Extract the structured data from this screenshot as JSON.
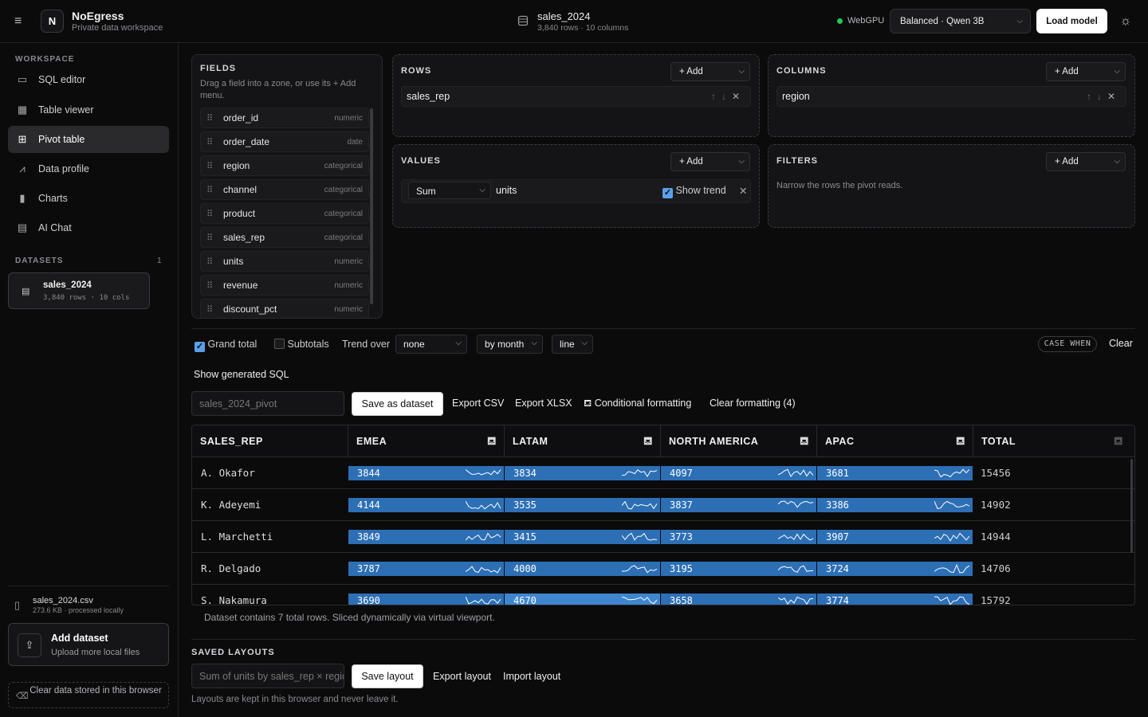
{
  "app": {
    "name": "NoEgress",
    "subtitle": "Private data workspace"
  },
  "header": {
    "dataset_name": "sales_2024",
    "dataset_meta": "3,840 rows · 10 columns",
    "gpu_label": "WebGPU",
    "model_select": "Balanced · Qwen 3B",
    "load_model": "Load model"
  },
  "sidebar": {
    "workspace_label": "WORKSPACE",
    "nav": [
      {
        "label": "SQL editor",
        "icon": "terminal-icon"
      },
      {
        "label": "Table viewer",
        "icon": "table-icon"
      },
      {
        "label": "Pivot table",
        "icon": "pivot-icon",
        "active": true
      },
      {
        "label": "Data profile",
        "icon": "profile-icon"
      },
      {
        "label": "Charts",
        "icon": "bar-chart-icon"
      },
      {
        "label": "AI Chat",
        "icon": "chat-icon"
      }
    ],
    "datasets_label": "DATASETS",
    "datasets_count": "1",
    "dataset_card": {
      "name": "sales_2024",
      "meta": "3,840 rows · 10 cols"
    },
    "file": {
      "name": "sales_2024.csv",
      "meta": "273.6 KB · processed locally"
    },
    "add_dataset": {
      "title": "Add dataset",
      "subtitle": "Upload more local files"
    },
    "clear_data": "Clear data stored in this browser"
  },
  "fields_panel": {
    "title": "FIELDS",
    "help": "Drag a field into a zone, or use its + Add menu.",
    "fields": [
      {
        "name": "order_id",
        "type": "numeric"
      },
      {
        "name": "order_date",
        "type": "date"
      },
      {
        "name": "region",
        "type": "categorical"
      },
      {
        "name": "channel",
        "type": "categorical"
      },
      {
        "name": "product",
        "type": "categorical"
      },
      {
        "name": "sales_rep",
        "type": "categorical"
      },
      {
        "name": "units",
        "type": "numeric"
      },
      {
        "name": "revenue",
        "type": "numeric"
      },
      {
        "name": "discount_pct",
        "type": "numeric"
      }
    ]
  },
  "zones": {
    "add_label": "+ Add",
    "rows": {
      "title": "ROWS",
      "item": "sales_rep"
    },
    "columns": {
      "title": "COLUMNS",
      "item": "region"
    },
    "values": {
      "title": "VALUES",
      "agg": "Sum",
      "field": "units",
      "trend_label": "Show trend"
    },
    "filters": {
      "title": "FILTERS",
      "note": "Narrow the rows the pivot reads."
    }
  },
  "options": {
    "grand_total": "Grand total",
    "subtotals": "Subtotals",
    "trend_over": "Trend over",
    "trend_field": "none",
    "trend_period": "by month",
    "trend_style": "line",
    "case_when": "CASE WHEN",
    "clear": "Clear"
  },
  "actions": {
    "show_sql": "Show generated SQL",
    "dataset_name_placeholder": "sales_2024_pivot",
    "save_dataset": "Save as dataset",
    "export_csv": "Export CSV",
    "export_xlsx": "Export XLSX",
    "conditional_formatting": "Conditional formatting",
    "clear_formatting": "Clear formatting (4)"
  },
  "pivot": {
    "headers": [
      "SALES_REP",
      "EMEA",
      "LATAM",
      "NORTH AMERICA",
      "APAC",
      "TOTAL"
    ],
    "max_value": 4670,
    "rows": [
      {
        "rep": "A. Okafor",
        "values": [
          3844,
          3834,
          4097,
          3681
        ],
        "total": "15456"
      },
      {
        "rep": "K. Adeyemi",
        "values": [
          4144,
          3535,
          3837,
          3386
        ],
        "total": "14902"
      },
      {
        "rep": "L. Marchetti",
        "values": [
          3849,
          3415,
          3773,
          3907
        ],
        "total": "14944"
      },
      {
        "rep": "R. Delgado",
        "values": [
          3787,
          4000,
          3195,
          3724
        ],
        "total": "14706"
      },
      {
        "rep": "S. Nakamura",
        "values": [
          3690,
          4670,
          3658,
          3774
        ],
        "total": "15792"
      }
    ],
    "note": "Dataset contains 7 total rows. Sliced dynamically via virtual viewport."
  },
  "saved_layouts": {
    "title": "SAVED LAYOUTS",
    "name_placeholder": "Sum of units by sales_rep × region",
    "save": "Save layout",
    "export": "Export layout",
    "import": "Import layout",
    "note": "Layouts are kept in this browser and never leave it."
  },
  "colors": {
    "accent": "#2d6fb5",
    "bar_light": "#3f86cf",
    "check": "#5aa0e8",
    "status_ok": "#22c55e"
  }
}
